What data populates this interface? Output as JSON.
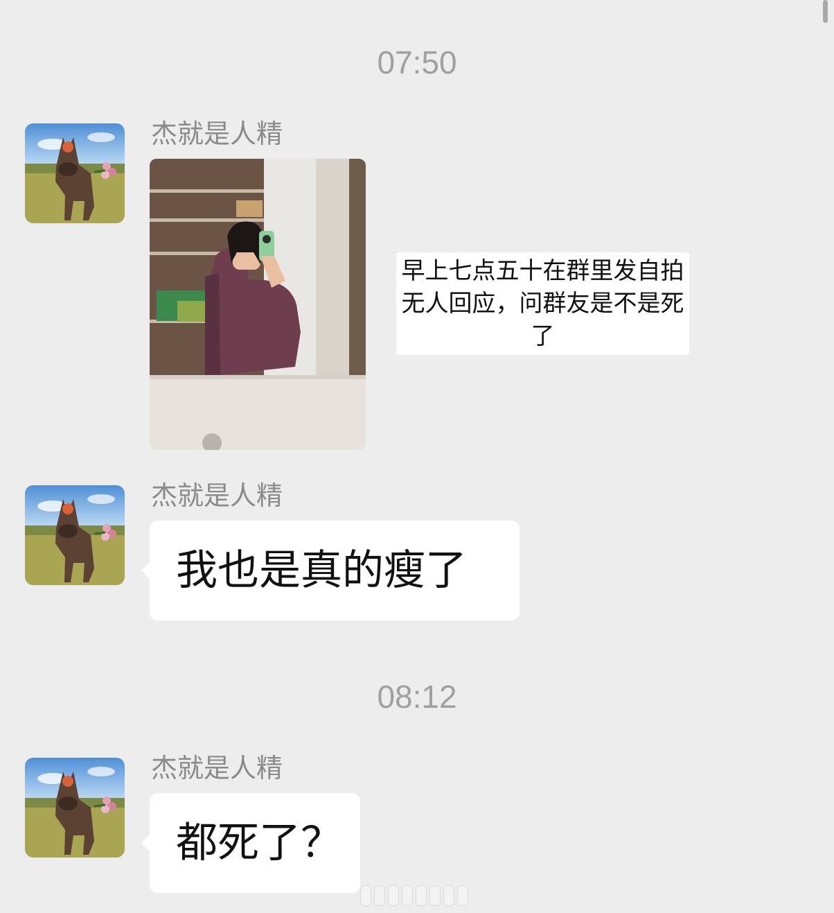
{
  "chat": {
    "timestamps": [
      "07:50",
      "08:12"
    ],
    "messages": [
      {
        "sender": "杰就是人精",
        "type": "image",
        "avatar_icon": "donkey-avatar-icon",
        "image_caption": "早上七点五十在群里发自拍无人回应，问群友是不是死了"
      },
      {
        "sender": "杰就是人精",
        "type": "text",
        "avatar_icon": "donkey-avatar-icon",
        "text": "我也是真的瘦了"
      },
      {
        "sender": "杰就是人精",
        "type": "text",
        "avatar_icon": "donkey-avatar-icon",
        "text": "都死了？"
      }
    ]
  },
  "colors": {
    "background": "#ededed",
    "bubble": "#ffffff",
    "timestamp": "#a0a0a0",
    "sender": "#8a8a8a"
  }
}
